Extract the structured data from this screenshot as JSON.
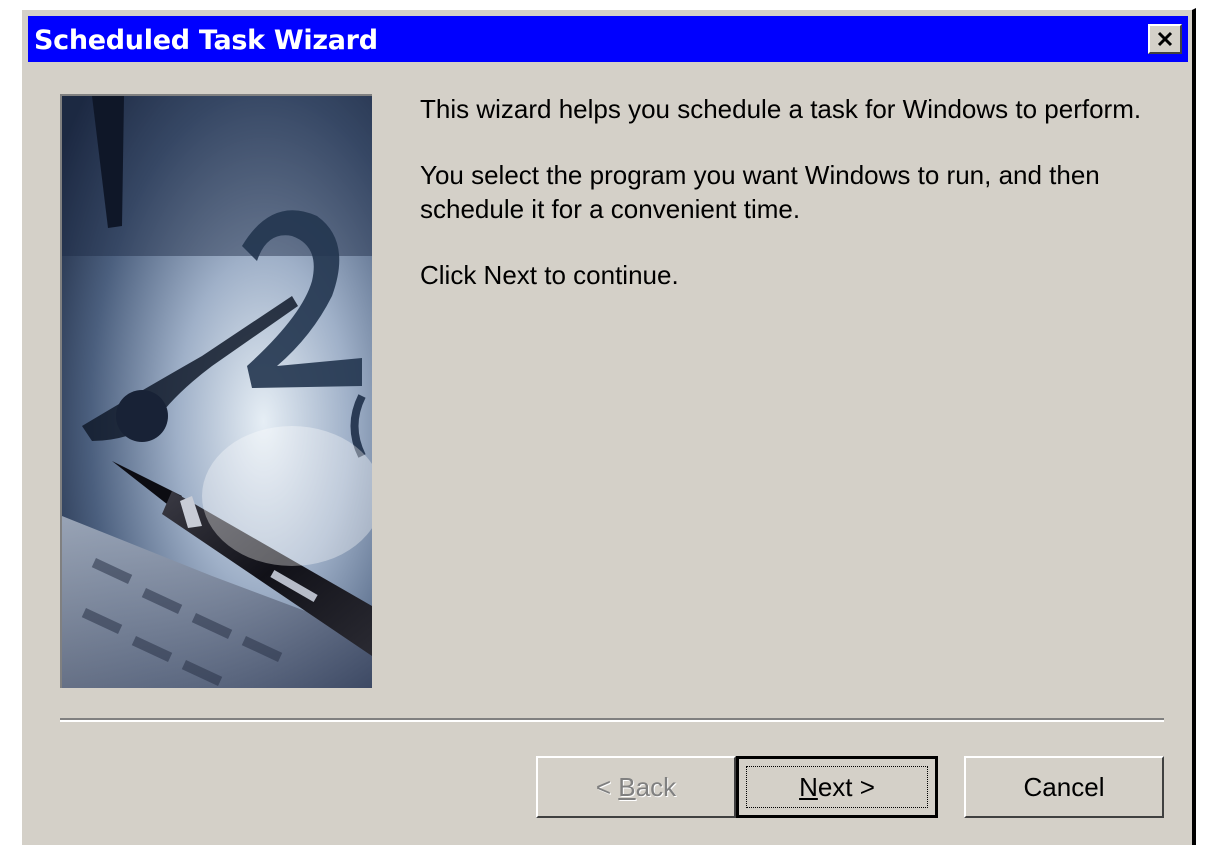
{
  "window": {
    "title": "Scheduled Task Wizard",
    "close_glyph": "✕"
  },
  "content": {
    "paragraph1": "This wizard helps you schedule a task for Windows to perform.",
    "paragraph2": "You select the program you want Windows to run, and then schedule it for a convenient time.",
    "paragraph3": "Click Next to continue."
  },
  "buttons": {
    "back_prefix": "< ",
    "back_hotkey": "B",
    "back_rest": "ack",
    "next_hotkey": "N",
    "next_rest": "ext >",
    "cancel": "Cancel"
  },
  "colors": {
    "titlebar": "#0000ff",
    "face": "#d4d0c8"
  },
  "icons": {
    "close": "close-icon",
    "banner": "clock-and-pen-illustration"
  }
}
